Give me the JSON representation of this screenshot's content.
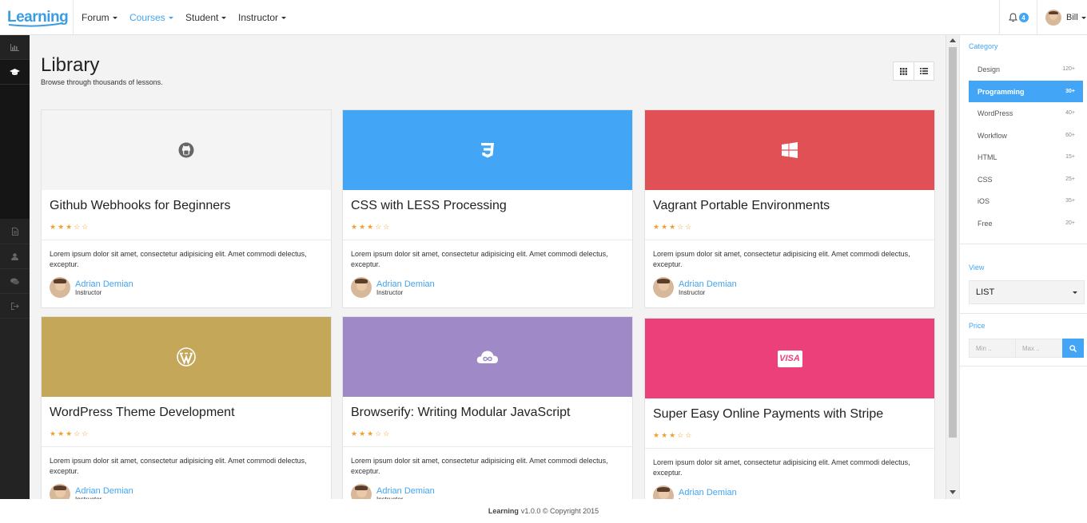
{
  "brand": {
    "logo_text": "Learning"
  },
  "topnav": {
    "items": [
      {
        "label": "Forum"
      },
      {
        "label": "Courses"
      },
      {
        "label": "Student"
      },
      {
        "label": "Instructor"
      }
    ],
    "notification_count": "4",
    "user_name": "Bill"
  },
  "left_sidebar": {
    "icons": [
      "bar-chart-icon",
      "graduation-cap-icon",
      "file-icon",
      "user-icon",
      "comments-icon",
      "sign-out-icon"
    ]
  },
  "page": {
    "title": "Library",
    "subtitle": "Browse through thousands of lessons."
  },
  "colors": {
    "accent": "#42a5f5",
    "github_bg": "#f4f4f4",
    "css_bg": "#42a5f5",
    "vagrant_bg": "#e05054",
    "wordpress_bg": "#c4a758",
    "browserify_bg": "#9f89c7",
    "stripe_bg": "#ec407a"
  },
  "courses": [
    {
      "title": "Github Webhooks for Beginners",
      "icon": "github-icon",
      "rating": 3,
      "max_rating": 5,
      "description": "Lorem ipsum dolor sit amet, consectetur adipisicing elit. Amet commodi delectus, exceptur.",
      "author": "Adrian Demian",
      "role": "Instructor"
    },
    {
      "title": "CSS with LESS Processing",
      "icon": "css3-icon",
      "rating": 3,
      "max_rating": 5,
      "description": "Lorem ipsum dolor sit amet, consectetur adipisicing elit. Amet commodi delectus, exceptur.",
      "author": "Adrian Demian",
      "role": "Instructor"
    },
    {
      "title": "Vagrant Portable Environments",
      "icon": "windows-icon",
      "rating": 3,
      "max_rating": 5,
      "description": "Lorem ipsum dolor sit amet, consectetur adipisicing elit. Amet commodi delectus, exceptur.",
      "author": "Adrian Demian",
      "role": "Instructor"
    },
    {
      "title": "WordPress Theme Development",
      "icon": "wordpress-icon",
      "rating": 3,
      "max_rating": 5,
      "description": "Lorem ipsum dolor sit amet, consectetur adipisicing elit. Amet commodi delectus, exceptur.",
      "author": "Adrian Demian",
      "role": "Instructor"
    },
    {
      "title": "Browserify: Writing Modular JavaScript",
      "icon": "cloud-icon",
      "rating": 3,
      "max_rating": 5,
      "description": "Lorem ipsum dolor sit amet, consectetur adipisicing elit. Amet commodi delectus, exceptur.",
      "author": "Adrian Demian",
      "role": "Instructor"
    },
    {
      "title": "Super Easy Online Payments with Stripe",
      "icon": "visa-icon",
      "icon_text": "VISA",
      "rating": 3,
      "max_rating": 5,
      "description": "Lorem ipsum dolor sit amet, consectetur adipisicing elit. Amet commodi delectus, exceptur.",
      "author": "Adrian Demian",
      "role": "Instructor"
    }
  ],
  "sidebar": {
    "category_heading": "Category",
    "categories": [
      {
        "label": "Design",
        "count": "120+"
      },
      {
        "label": "Programming",
        "count": "30+"
      },
      {
        "label": "WordPress",
        "count": "40+"
      },
      {
        "label": "Workflow",
        "count": "60+"
      },
      {
        "label": "HTML",
        "count": "15+"
      },
      {
        "label": "CSS",
        "count": "25+"
      },
      {
        "label": "iOS",
        "count": "35+"
      },
      {
        "label": "Free",
        "count": "20+"
      }
    ],
    "view_heading": "View",
    "view_value": "LIST",
    "price_heading": "Price",
    "price_min_placeholder": "Min ..",
    "price_max_placeholder": "Max .."
  },
  "footer": {
    "brand": "Learning",
    "text": "v1.0.0 © Copyright 2015"
  }
}
